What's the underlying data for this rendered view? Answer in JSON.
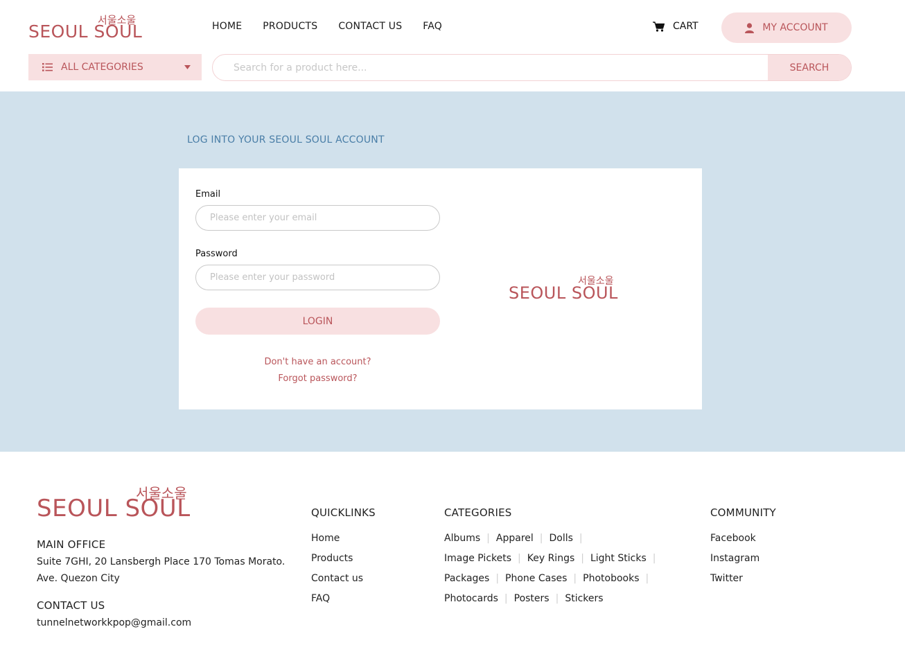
{
  "brand": {
    "korean": "서울소울",
    "english": "SEOUL SOUL"
  },
  "nav": {
    "items": [
      "HOME",
      "PRODUCTS",
      "CONTACT US",
      "FAQ"
    ]
  },
  "cart": {
    "label": "CART"
  },
  "account": {
    "label": "MY ACCOUNT"
  },
  "categories_button": {
    "label": "ALL CATEGORIES"
  },
  "search": {
    "placeholder": "Search for a product here...",
    "button_label": "SEARCH"
  },
  "login": {
    "heading": "LOG INTO YOUR SEOUL SOUL ACCOUNT",
    "email_label": "Email",
    "email_placeholder": "Please enter your email",
    "password_label": "Password",
    "password_placeholder": "Please enter your password",
    "button_label": "LOGIN",
    "signup_link": "Don't have an account?",
    "forgot_link": "Forgot password?"
  },
  "footer": {
    "main_office_heading": "MAIN OFFICE",
    "address_line1": "Suite 7GHI, 20 Lansbergh Place 170 Tomas Morato.",
    "address_line2": "Ave. Quezon City",
    "contact_heading": "CONTACT US",
    "email": "tunnelnetworkkpop@gmail.com",
    "quicklinks_heading": "QUICKLINKS",
    "quicklinks": [
      "Home",
      "Products",
      "Contact us",
      "FAQ"
    ],
    "categories_heading": "CATEGORIES",
    "category_rows": [
      [
        "Albums",
        "Apparel",
        "Dolls"
      ],
      [
        "Image Pickets",
        "Key Rings",
        "Light Sticks"
      ],
      [
        "Packages",
        "Phone Cases",
        "Photobooks"
      ],
      [
        "Photocards",
        "Posters",
        "Stickers"
      ]
    ],
    "community_heading": "COMMUNITY",
    "community": [
      "Facebook",
      "Instagram",
      "Twitter"
    ]
  },
  "colors": {
    "brand": "#b9555a",
    "pink_bg": "#f8e0e1",
    "main_bg": "#d1e1ec",
    "heading_blue": "#4a7ea7"
  },
  "icons": {
    "cart": "cart-icon",
    "account": "user-icon",
    "categories": "list-icon",
    "dropdown": "caret-down-icon"
  }
}
